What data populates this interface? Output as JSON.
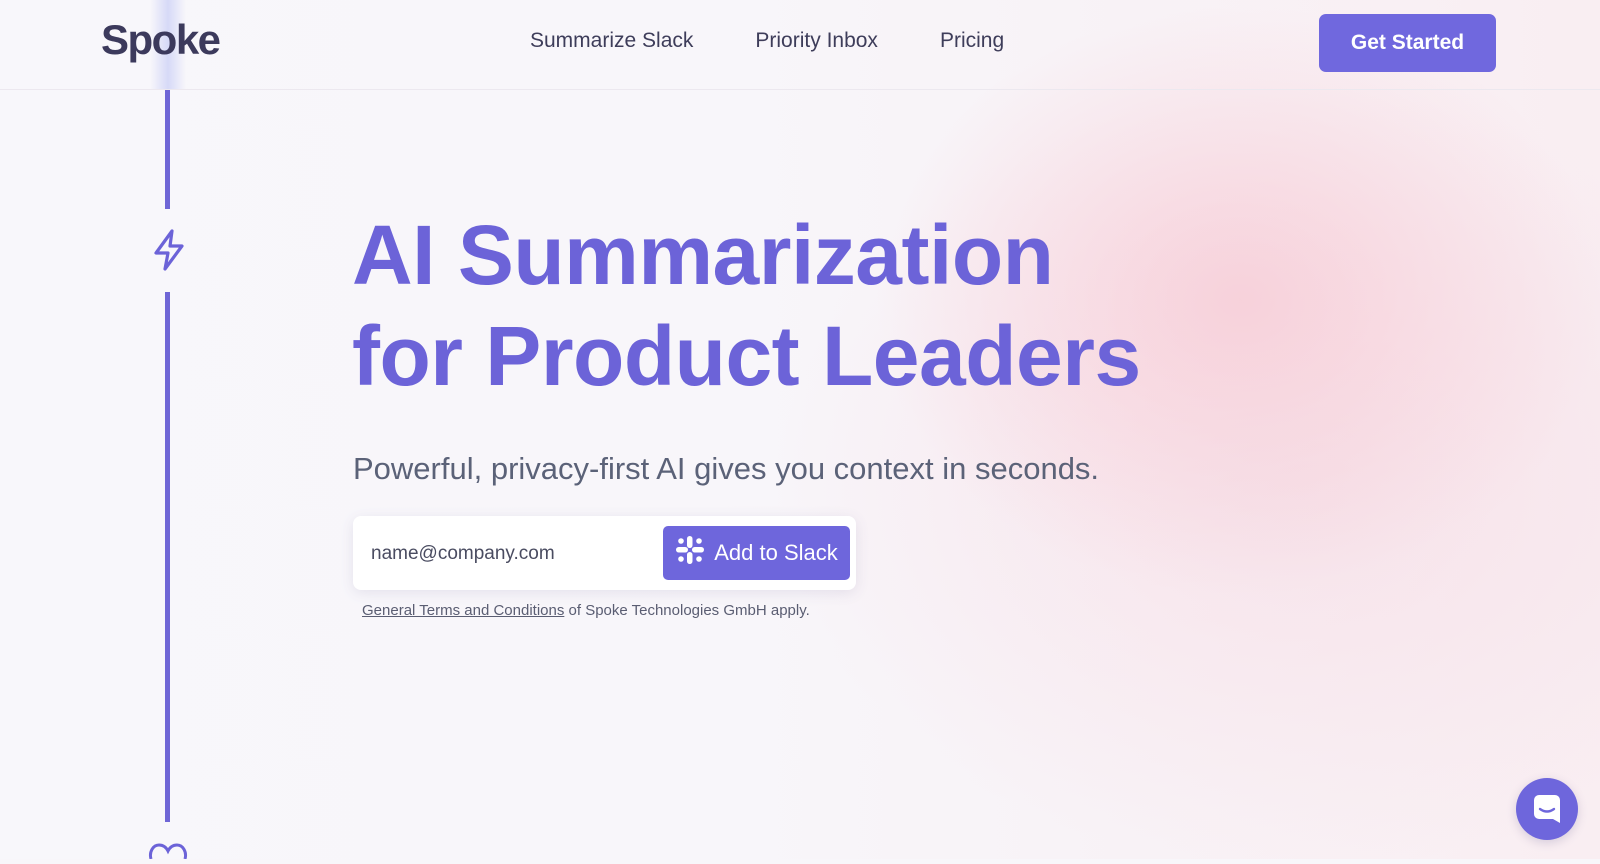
{
  "header": {
    "logo": "Spoke",
    "nav": [
      {
        "label": "Summarize Slack"
      },
      {
        "label": "Priority Inbox"
      },
      {
        "label": "Pricing"
      }
    ],
    "cta_label": "Get Started"
  },
  "hero": {
    "title_line1": "AI Summarization",
    "title_line2": "for Product Leaders",
    "subtitle": "Powerful, privacy-first AI gives you context in seconds.",
    "email_placeholder": "name@company.com",
    "slack_button_label": "Add to Slack",
    "terms_link": "General Terms and Conditions",
    "terms_text": "of Spoke Technologies GmbH apply."
  },
  "rail": {
    "icons": [
      "lightning-icon",
      "heart-icon"
    ]
  },
  "colors": {
    "accent": "#6c63d8",
    "text_dark": "#3c3a5c",
    "text_muted": "#5b6278"
  }
}
